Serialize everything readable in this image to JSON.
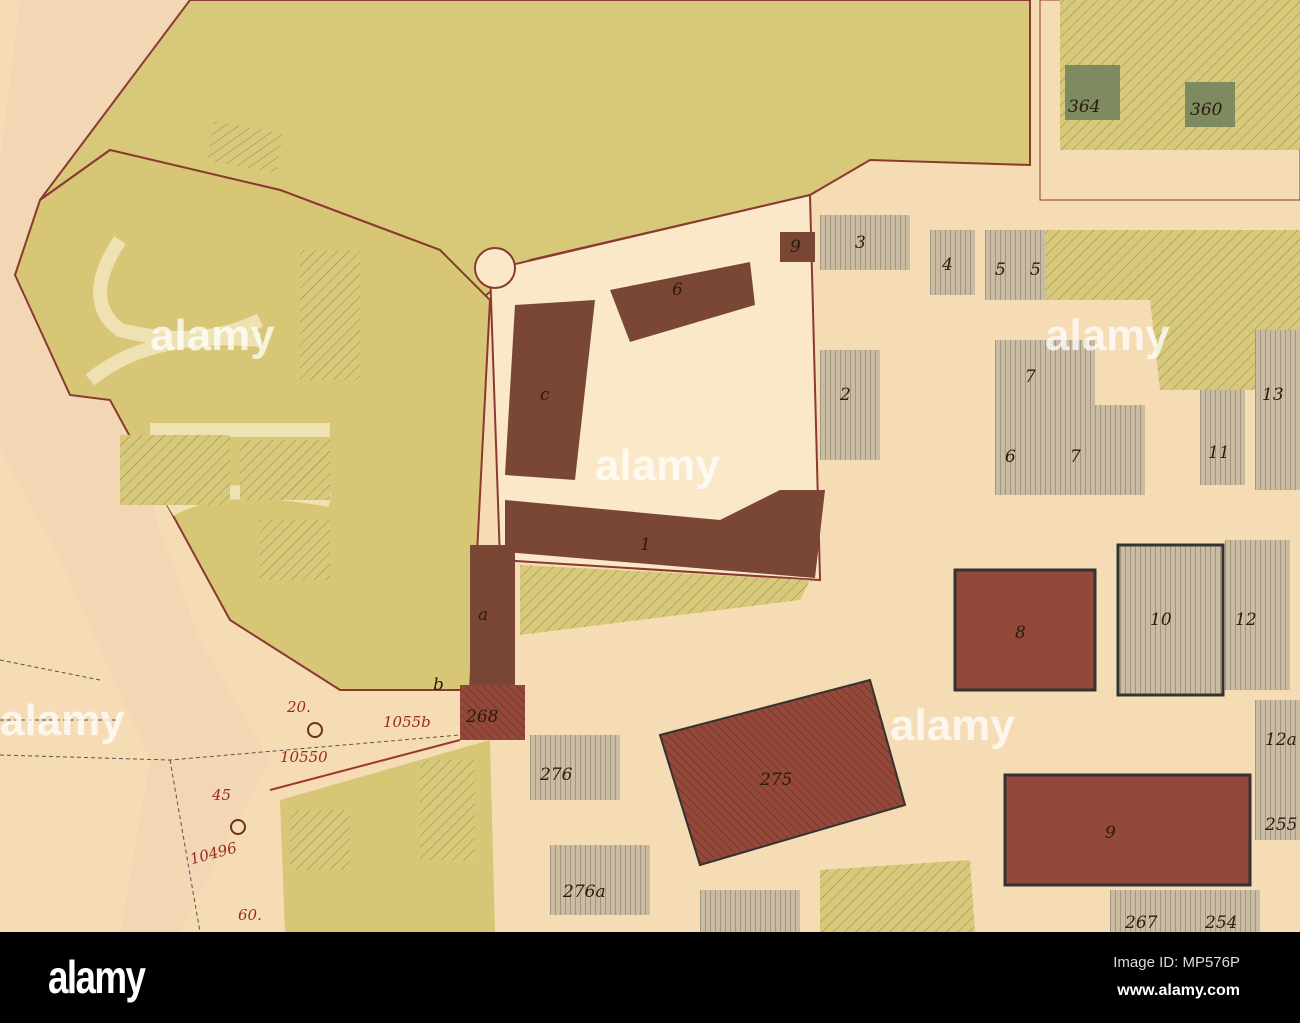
{
  "map": {
    "parcel_labels": [
      "3",
      "4",
      "5",
      "5",
      "6",
      "9",
      "c",
      "2",
      "1",
      "7",
      "6",
      "7",
      "11",
      "13",
      "8",
      "10",
      "12",
      "275",
      "276",
      "276a",
      "9",
      "364",
      "360",
      "12a",
      "255",
      "267",
      "254",
      "a",
      "b",
      "268"
    ],
    "survey_labels": [
      "20.",
      "45",
      "60.",
      "10550",
      "1055b",
      "10496"
    ],
    "watermark": "alamy",
    "colors": {
      "paper": "#f6dcb4",
      "garden": "#d8c97a",
      "building_dark": "#7a4636",
      "building_red": "#94483a",
      "building_gray": "#c9bca2",
      "boundary": "#9a3a30"
    }
  },
  "footer": {
    "logo": "alamy",
    "image_id": "Image ID: MP576P",
    "url": "www.alamy.com"
  }
}
